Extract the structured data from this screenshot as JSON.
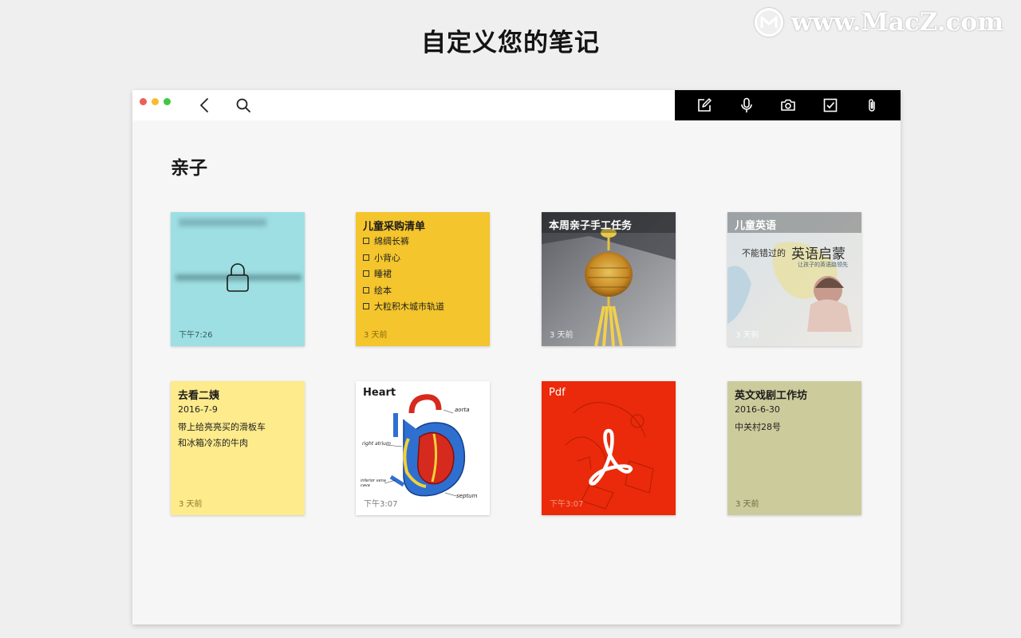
{
  "headline": "自定义您的笔记",
  "watermark": "www.MacZ.com",
  "toolbar": {
    "back": "back-icon",
    "search": "search-icon",
    "tools": [
      "compose-icon",
      "microphone-icon",
      "camera-icon",
      "checklist-icon",
      "paperclip-icon"
    ]
  },
  "folder_title": "亲子",
  "notes": [
    {
      "kind": "locked",
      "time": "下午7:26",
      "color": "#9ddfe2"
    },
    {
      "kind": "checklist",
      "title": "儿童采购清单",
      "items": [
        "绵绸长裤",
        "小背心",
        "睡裙",
        "绘本",
        "大粒积木城市轨道"
      ],
      "time": "3 天前",
      "color": "#f4c52c"
    },
    {
      "kind": "photo",
      "title": "本周亲子手工任务",
      "time": "3 天前"
    },
    {
      "kind": "photo",
      "title": "儿童英语",
      "image_text": [
        "不能错过的",
        "英语启蒙",
        "让孩子的英语路领先"
      ],
      "time": "3 天前"
    },
    {
      "kind": "text",
      "title": "去看二姨",
      "lines": [
        "2016-7-9",
        "带上给亮亮买的滑板车",
        "和冰箱冷冻的牛肉"
      ],
      "time": "3 天前",
      "color": "#fdeb8c"
    },
    {
      "kind": "drawing",
      "title": "Heart",
      "time": "下午3:07",
      "labels": [
        "aorta",
        "right atrium",
        "inferior vena cava",
        "septum"
      ]
    },
    {
      "kind": "pdf",
      "title": "Pdf",
      "time": "下午3:07",
      "color": "#ea2a0a"
    },
    {
      "kind": "text",
      "title": "英文戏剧工作坊",
      "lines": [
        "2016-6-30",
        "中关村28号"
      ],
      "time": "3 天前",
      "color": "#cccb9c"
    }
  ]
}
